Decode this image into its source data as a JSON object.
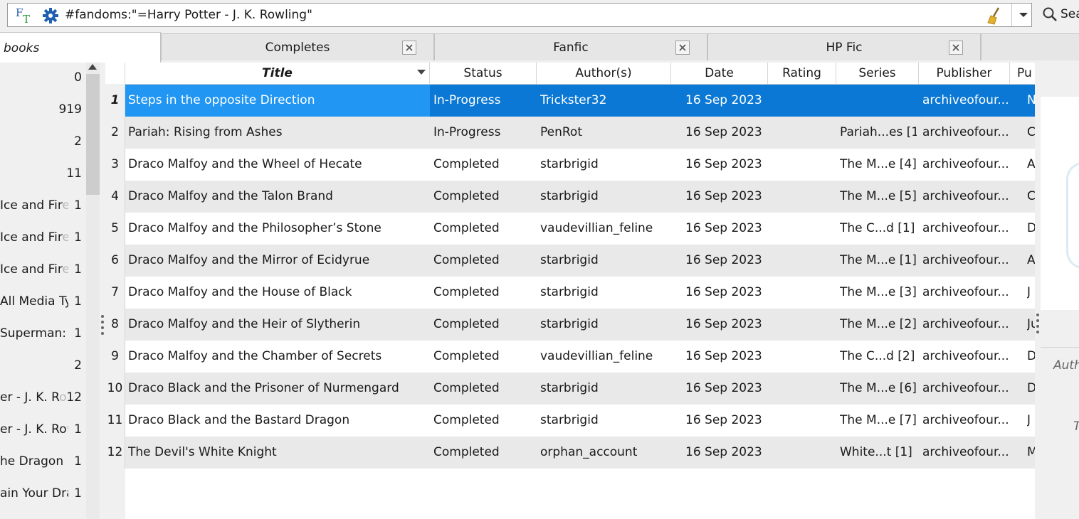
{
  "search": {
    "query": "#fandoms:\"=Harry Potter - J. K. Rowling\"",
    "button_label": "Sea"
  },
  "tabs": [
    {
      "label": "books",
      "active": true
    },
    {
      "label": "Completes",
      "active": false
    },
    {
      "label": "Fanfic",
      "active": false
    },
    {
      "label": "HP Fic",
      "active": false
    }
  ],
  "tag_browser": [
    {
      "name": "",
      "count": "0"
    },
    {
      "name": "",
      "count": "919"
    },
    {
      "name": "",
      "count": "2"
    },
    {
      "name": "",
      "count": "11"
    },
    {
      "name": "Ice and Fire",
      "count": "1"
    },
    {
      "name": "Ice and Fire",
      "count": "1"
    },
    {
      "name": "Ice and Fire",
      "count": "1"
    },
    {
      "name": "All Media Typ",
      "count": "1"
    },
    {
      "name": "Superman: D",
      "count": "1"
    },
    {
      "name": "",
      "count": "2"
    },
    {
      "name": "er - J. K. Ro",
      "count": "12"
    },
    {
      "name": "er - J. K. Row",
      "count": "1"
    },
    {
      "name": "he Dragon (",
      "count": "1"
    },
    {
      "name": "ain Your Drag",
      "count": "1"
    }
  ],
  "columns": {
    "title": "Title",
    "status": "Status",
    "authors": "Author(s)",
    "date": "Date",
    "rating": "Rating",
    "series": "Series",
    "publisher": "Publisher",
    "pub": "Pu"
  },
  "books": [
    {
      "num": "1",
      "title": "Steps in the opposite Direction",
      "status": "In-Progress",
      "author": "Trickster32",
      "date": "16 Sep 2023",
      "rating": "",
      "series": "",
      "publisher": "archiveofour...",
      "extra": "N"
    },
    {
      "num": "2",
      "title": "Pariah: Rising from Ashes",
      "status": "In-Progress",
      "author": "PenRot",
      "date": "16 Sep 2023",
      "rating": "",
      "series": "Pariah...es [1]",
      "publisher": "archiveofour...",
      "extra": "C"
    },
    {
      "num": "3",
      "title": "Draco Malfoy and the Wheel of Hecate",
      "status": "Completed",
      "author": "starbrigid",
      "date": "16 Sep 2023",
      "rating": "",
      "series": "The M...e [4]",
      "publisher": "archiveofour...",
      "extra": "A"
    },
    {
      "num": "4",
      "title": "Draco Malfoy and the Talon Brand",
      "status": "Completed",
      "author": "starbrigid",
      "date": "16 Sep 2023",
      "rating": "",
      "series": "The M...e [5]",
      "publisher": "archiveofour...",
      "extra": "C"
    },
    {
      "num": "5",
      "title": "Draco Malfoy and the Philosopher’s Stone",
      "status": "Completed",
      "author": "vaudevillian_feline",
      "date": "16 Sep 2023",
      "rating": "",
      "series": "The C...d [1]",
      "publisher": "archiveofour...",
      "extra": "D"
    },
    {
      "num": "6",
      "title": "Draco Malfoy and the Mirror of Ecidyrue",
      "status": "Completed",
      "author": "starbrigid",
      "date": "16 Sep 2023",
      "rating": "",
      "series": "The M...e [1]",
      "publisher": "archiveofour...",
      "extra": "A"
    },
    {
      "num": "7",
      "title": "Draco Malfoy and the House of Black",
      "status": "Completed",
      "author": "starbrigid",
      "date": "16 Sep 2023",
      "rating": "",
      "series": "The M...e [3]",
      "publisher": "archiveofour...",
      "extra": "J"
    },
    {
      "num": "8",
      "title": "Draco Malfoy and the Heir of Slytherin",
      "status": "Completed",
      "author": "starbrigid",
      "date": "16 Sep 2023",
      "rating": "",
      "series": "The M...e [2]",
      "publisher": "archiveofour...",
      "extra": "Ju"
    },
    {
      "num": "9",
      "title": "Draco Malfoy and the Chamber of Secrets",
      "status": "Completed",
      "author": "vaudevillian_feline",
      "date": "16 Sep 2023",
      "rating": "",
      "series": "The C...d [2]",
      "publisher": "archiveofour...",
      "extra": "D"
    },
    {
      "num": "10",
      "title": "Draco Black and the Prisoner of Nurmengard",
      "status": "Completed",
      "author": "starbrigid",
      "date": "16 Sep 2023",
      "rating": "",
      "series": "The M...e [6]",
      "publisher": "archiveofour...",
      "extra": "D"
    },
    {
      "num": "11",
      "title": "Draco Black and the Bastard Dragon",
      "status": "Completed",
      "author": "starbrigid",
      "date": "16 Sep 2023",
      "rating": "",
      "series": "The M...e [7]",
      "publisher": "archiveofour...",
      "extra": "J"
    },
    {
      "num": "12",
      "title": "The Devil's White Knight",
      "status": "Completed",
      "author": "orphan_account",
      "date": "16 Sep 2023",
      "rating": "",
      "series": "White...t [1]",
      "publisher": "archiveofour...",
      "extra": "M"
    }
  ],
  "right_pane": {
    "label_auth": "Auth",
    "label_t": "T"
  },
  "colors": {
    "selection": "#0a78d4",
    "selection_title": "#2196f3",
    "alt_row": "#e9e9e9"
  }
}
